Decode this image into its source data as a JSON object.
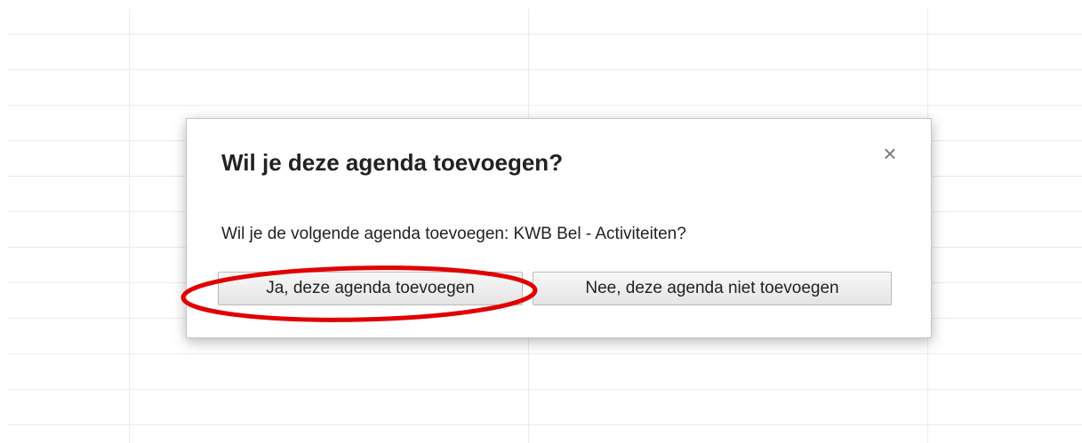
{
  "dialog": {
    "title": "Wil je deze agenda toevoegen?",
    "close_symbol": "×",
    "message": "Wil je de volgende agenda toevoegen: KWB Bel - Activiteiten?",
    "confirm_label": "Ja, deze agenda toevoegen",
    "decline_label": "Nee, deze agenda niet toevoegen"
  },
  "annotation": {
    "highlight_color": "#e00000",
    "target": "Ja, deze agenda toevoegen"
  }
}
